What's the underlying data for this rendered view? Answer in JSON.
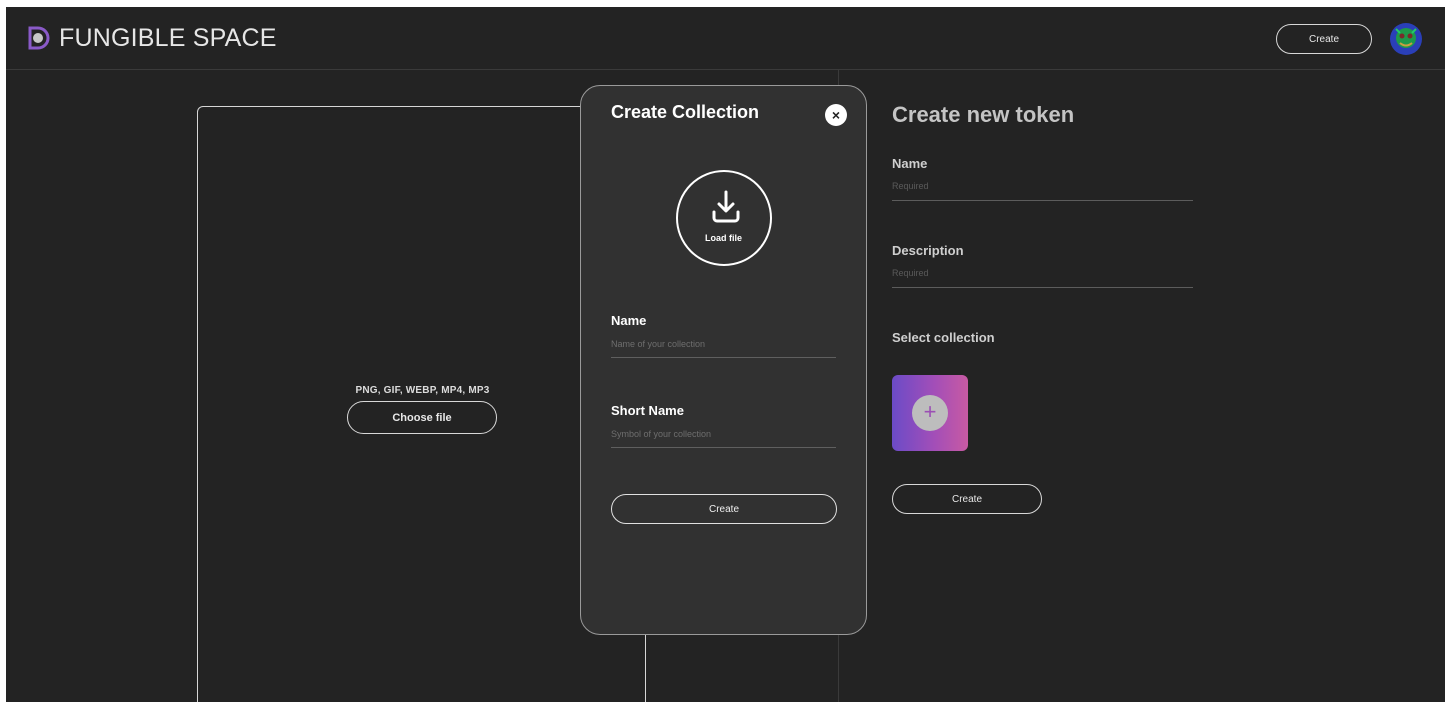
{
  "header": {
    "brand": "FUNGIBLE SPACE",
    "create_label": "Create"
  },
  "upload": {
    "formats": "PNG, GIF, WEBP, MP4, MP3",
    "choose_label": "Choose file"
  },
  "token_form": {
    "title": "Create new token",
    "name_label": "Name",
    "name_placeholder": "Required",
    "description_label": "Description",
    "description_placeholder": "Required",
    "collection_label": "Select collection",
    "add_symbol": "+",
    "create_label": "Create"
  },
  "modal": {
    "title": "Create Collection",
    "close_symbol": "×",
    "load_label": "Load file",
    "name_label": "Name",
    "name_placeholder": "Name of your collection",
    "short_name_label": "Short Name",
    "short_name_placeholder": "Symbol of your collection",
    "create_label": "Create"
  },
  "colors": {
    "background": "#232323",
    "modal_background": "#313131",
    "accent_gradient_start": "#6b4bc7",
    "accent_gradient_end": "#c85aa3"
  },
  "icons": [
    "logo-icon",
    "avatar",
    "download-icon",
    "close-icon",
    "plus-icon"
  ]
}
